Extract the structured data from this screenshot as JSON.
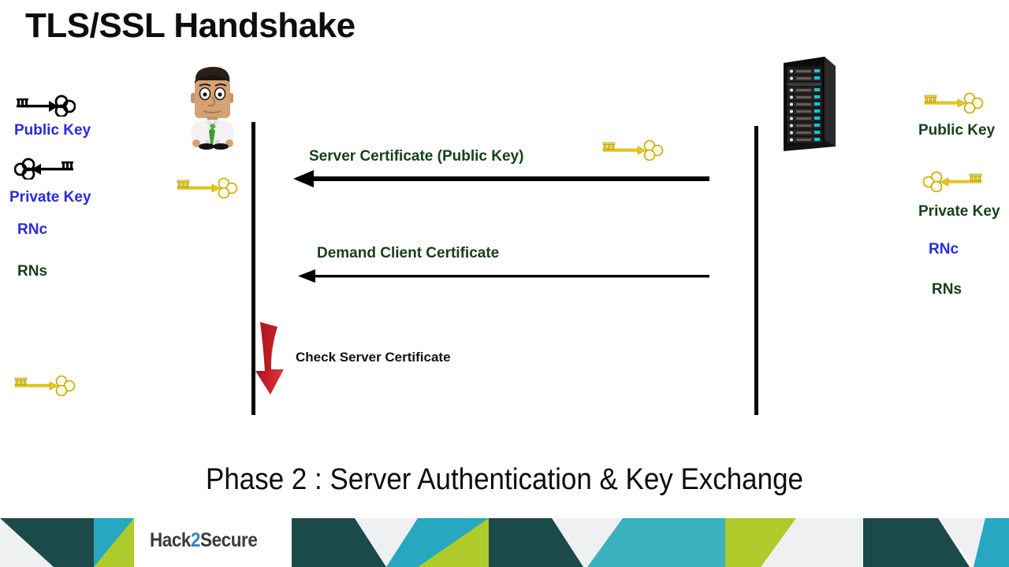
{
  "slide": {
    "title": "TLS/SSL Handshake",
    "phase_caption": "Phase 2 : Server Authentication & Key Exchange",
    "background_color": "#ffffff"
  },
  "colors": {
    "blue_label": "#2a2ae0",
    "green_label": "#16401d",
    "note_black": "#111111",
    "red_arrow": "#c8202a",
    "key_gold": "#d9b70d",
    "logo_blue": "#2f87c9",
    "footer_teal_dark": "#1c4a4a",
    "footer_cyan": "#27a7c0",
    "footer_lime": "#aecb2b",
    "footer_white": "#eef0f1"
  },
  "left_legend": {
    "entries": [
      {
        "icon": "key-icon-black-right",
        "label": "Public Key",
        "color": "blue"
      },
      {
        "icon": "key-icon-black-left",
        "label": "Private Key",
        "color": "blue"
      },
      {
        "icon": "none",
        "label": "RNc",
        "color": "blue"
      },
      {
        "icon": "none",
        "label": "RNs",
        "color": "green"
      }
    ]
  },
  "right_legend": {
    "entries": [
      {
        "icon": "key-icon-gold-right",
        "label": "Public Key",
        "color": "green"
      },
      {
        "icon": "key-icon-gold-left",
        "label": "Private Key",
        "color": "green"
      },
      {
        "icon": "none",
        "label": "RNc",
        "color": "blue"
      },
      {
        "icon": "none",
        "label": "RNs",
        "color": "green"
      }
    ]
  },
  "actors": {
    "client": {
      "name": "client-figure",
      "description": "cartoon man in white shirt with green tie"
    },
    "server": {
      "name": "server-rack",
      "description": "black server tower with cyan indicator lights"
    }
  },
  "messages": [
    {
      "label": "Server Certificate (Public Key)",
      "direction": "server-to-client",
      "arrow_style": "thick",
      "has_key_icon": true
    },
    {
      "label": "Demand Client Certificate",
      "direction": "server-to-client",
      "arrow_style": "thin",
      "has_key_icon": false
    }
  ],
  "notes": [
    {
      "label": "Check Server Certificate",
      "arrow": "red-curved-down-arrow"
    }
  ],
  "loose_keys": [
    {
      "name": "key-client-holds",
      "color": "gold"
    },
    {
      "name": "key-bottom-left",
      "color": "gold"
    },
    {
      "name": "key-server-certificate",
      "color": "gold"
    }
  ],
  "footer": {
    "logo_part1": "Hack",
    "logo_part2": "2",
    "logo_part3": "Secure"
  }
}
